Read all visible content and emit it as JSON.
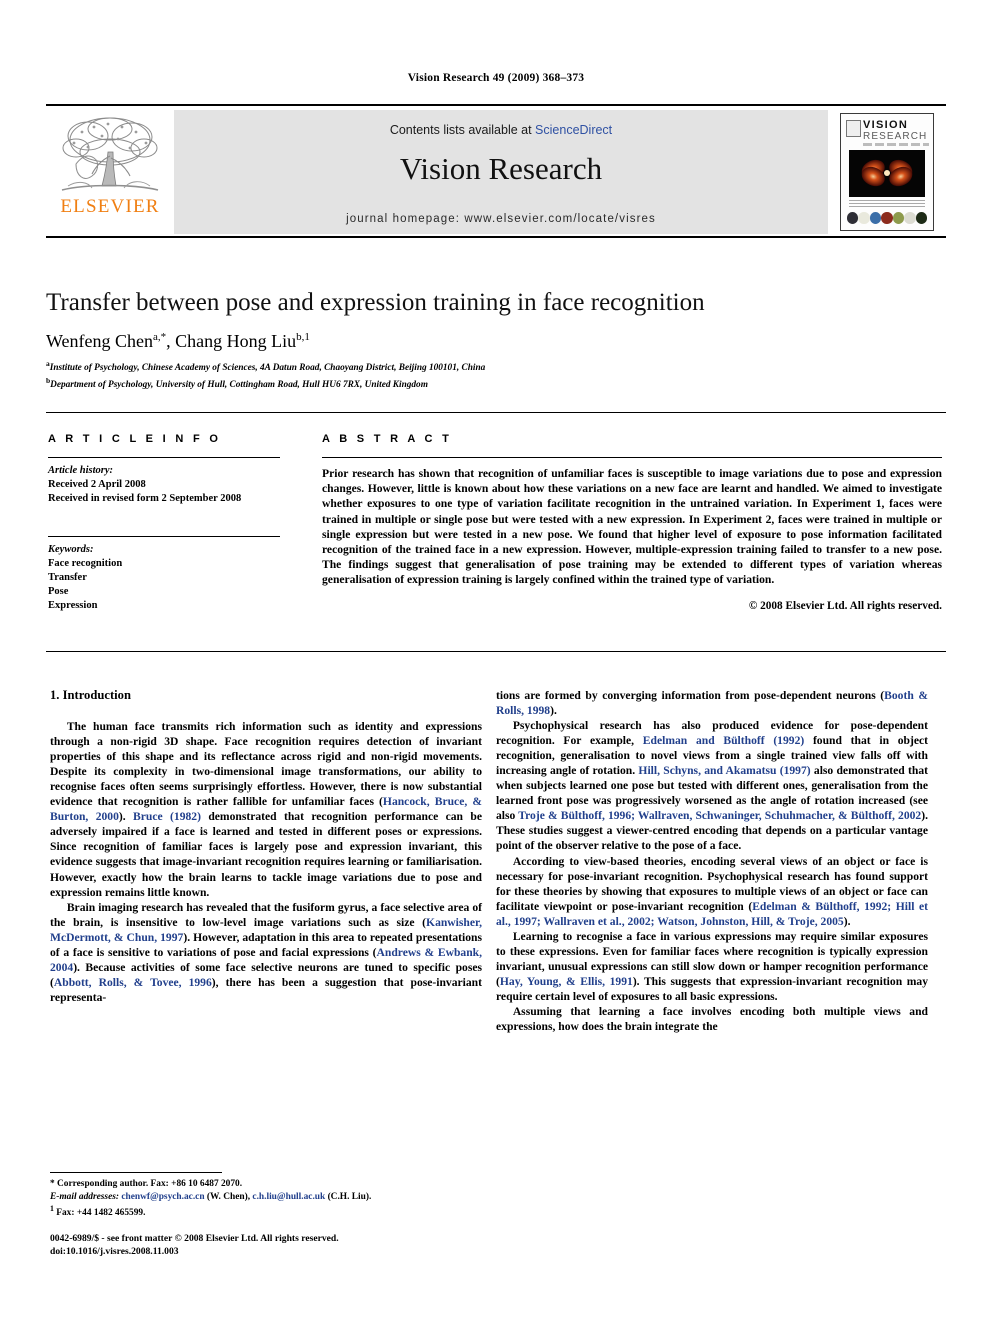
{
  "running_head": "Vision Research 49 (2009) 368–373",
  "masthead": {
    "publisher_logo_label": "ELSEVIER",
    "contents_prefix": "Contents lists available at ",
    "contents_link": "ScienceDirect",
    "journal_title": "Vision Research",
    "homepage": "journal homepage: www.elsevier.com/locate/visres",
    "cover": {
      "line1": "VISION",
      "line2": "RESEARCH"
    },
    "link_color": "#2f51a3",
    "panel_color": "#e3e3e3",
    "brand_color": "#F07F13"
  },
  "article": {
    "title": "Transfer between pose and expression training in face recognition",
    "authors": [
      {
        "name": "Wenfeng Chen",
        "marks": "a,*"
      },
      {
        "name": "Chang Hong Liu",
        "marks": "b,1"
      }
    ],
    "affiliations": [
      {
        "mark": "a",
        "text": "Institute of Psychology, Chinese Academy of Sciences, 4A Datun Road, Chaoyang District, Beijing 100101, China"
      },
      {
        "mark": "b",
        "text": "Department of Psychology, University of Hull, Cottingham Road, Hull HU6 7RX, United Kingdom"
      }
    ]
  },
  "article_info": {
    "heading": "A R T I C L E  I N F O",
    "history_label": "Article history:",
    "history": [
      "Received 2 April 2008",
      "Received in revised form 2 September 2008"
    ],
    "keywords_label": "Keywords:",
    "keywords": [
      "Face recognition",
      "Transfer",
      "Pose",
      "Expression"
    ]
  },
  "abstract": {
    "heading": "A B S T R A C T",
    "text": "Prior research has shown that recognition of unfamiliar faces is susceptible to image variations due to pose and expression changes. However, little is known about how these variations on a new face are learnt and handled. We aimed to investigate whether exposures to one type of variation facilitate recognition in the untrained variation. In Experiment 1, faces were trained in multiple or single pose but were tested with a new expression. In Experiment 2, faces were trained in multiple or single expression but were tested in a new pose. We found that higher level of exposure to pose information facilitated recognition of the trained face in a new expression. However, multiple-expression training failed to transfer to a new pose. The findings suggest that generalisation of pose training may be extended to different types of variation whereas generalisation of expression training is largely confined within the trained type of variation.",
    "copyright": "© 2008 Elsevier Ltd. All rights reserved."
  },
  "body": {
    "section_heading": "1. Introduction",
    "left_paragraphs": [
      {
        "parts": [
          {
            "t": "The human face transmits rich information such as identity and expressions through a non-rigid 3D shape. Face recognition requires detection of invariant properties of this shape and its reflectance across rigid and non-rigid movements. Despite its complexity in two-dimensional image transformations, our ability to recognise faces often seems surprisingly effortless. However, there is now substantial evidence that recognition is rather fallible for unfamiliar faces ("
          },
          {
            "t": "Hancock, Bruce, & Burton, 2000",
            "cite": true
          },
          {
            "t": "). "
          },
          {
            "t": "Bruce (1982)",
            "cite": true
          },
          {
            "t": " demonstrated that recognition performance can be adversely impaired if a face is learned and tested in different poses or expressions. Since recognition of familiar faces is largely pose and expression invariant, this evidence suggests that image-invariant recognition requires learning or familiarisation. However, exactly how the brain learns to tackle image variations due to pose and expression remains little known."
          }
        ]
      },
      {
        "parts": [
          {
            "t": "Brain imaging research has revealed that the fusiform gyrus, a face selective area of the brain, is insensitive to low-level image variations such as size ("
          },
          {
            "t": "Kanwisher, McDermott, & Chun, 1997",
            "cite": true
          },
          {
            "t": "). However, adaptation in this area to repeated presentations of a face is sensitive to variations of pose and facial expressions ("
          },
          {
            "t": "Andrews & Ewbank, 2004",
            "cite": true
          },
          {
            "t": "). Because activities of some face selective neurons are tuned to specific poses ("
          },
          {
            "t": "Abbott, Rolls, & Tovee, 1996",
            "cite": true
          },
          {
            "t": "), there has been a suggestion that pose-invariant representa-"
          }
        ]
      }
    ],
    "right_paragraphs": [
      {
        "noindent": true,
        "parts": [
          {
            "t": "tions are formed by converging information from pose-dependent neurons ("
          },
          {
            "t": "Booth & Rolls, 1998",
            "cite": true
          },
          {
            "t": ")."
          }
        ]
      },
      {
        "parts": [
          {
            "t": "Psychophysical research has also produced evidence for pose-dependent recognition. For example, "
          },
          {
            "t": "Edelman and Bülthoff (1992)",
            "cite": true
          },
          {
            "t": " found that in object recognition, generalisation to novel views from a single trained view falls off with increasing angle of rotation. "
          },
          {
            "t": "Hill, Schyns, and Akamatsu (1997)",
            "cite": true
          },
          {
            "t": " also demonstrated that when subjects learned one pose but tested with different ones, generalisation from the learned front pose was progressively worsened as the angle of rotation increased (see also "
          },
          {
            "t": "Troje & Bülthoff, 1996; Wallraven, Schwaninger, Schuhmacher, & Bülthoff, 2002",
            "cite": true
          },
          {
            "t": "). These studies suggest a viewer-centred encoding that depends on a particular vantage point of the observer relative to the pose of a face."
          }
        ]
      },
      {
        "parts": [
          {
            "t": "According to view-based theories, encoding several views of an object or face is necessary for pose-invariant recognition. Psychophysical research has found support for these theories by showing that exposures to multiple views of an object or face can facilitate viewpoint or pose-invariant recognition ("
          },
          {
            "t": "Edelman & Bülthoff, 1992; Hill et al., 1997; Wallraven et al., 2002; Watson, Johnston, Hill, & Troje, 2005",
            "cite": true
          },
          {
            "t": ")."
          }
        ]
      },
      {
        "parts": [
          {
            "t": "Learning to recognise a face in various expressions may require similar exposures to these expressions. Even for familiar faces where recognition is typically expression invariant, unusual expressions can still slow down or hamper recognition performance ("
          },
          {
            "t": "Hay, Young, & Ellis, 1991",
            "cite": true
          },
          {
            "t": "). This suggests that expression-invariant recognition may require certain level of exposures to all basic expressions."
          }
        ]
      },
      {
        "parts": [
          {
            "t": "Assuming that learning a face involves encoding both multiple views and expressions, how does the brain integrate the"
          }
        ]
      }
    ]
  },
  "footnotes": {
    "corresponding": "* Corresponding author. Fax: +86 10 6487 2070.",
    "email_label": "E-mail addresses:",
    "emails": [
      {
        "address": "chenwf@psych.ac.cn",
        "owner": "(W. Chen)"
      },
      {
        "address": "c.h.liu@hull.ac.uk",
        "owner": "(C.H. Liu)"
      }
    ],
    "note1_mark": "1",
    "note1": "Fax: +44 1482 465599."
  },
  "imprint": {
    "line1": "0042-6989/$ - see front matter © 2008 Elsevier Ltd. All rights reserved.",
    "line2": "doi:10.1016/j.visres.2008.11.003"
  }
}
